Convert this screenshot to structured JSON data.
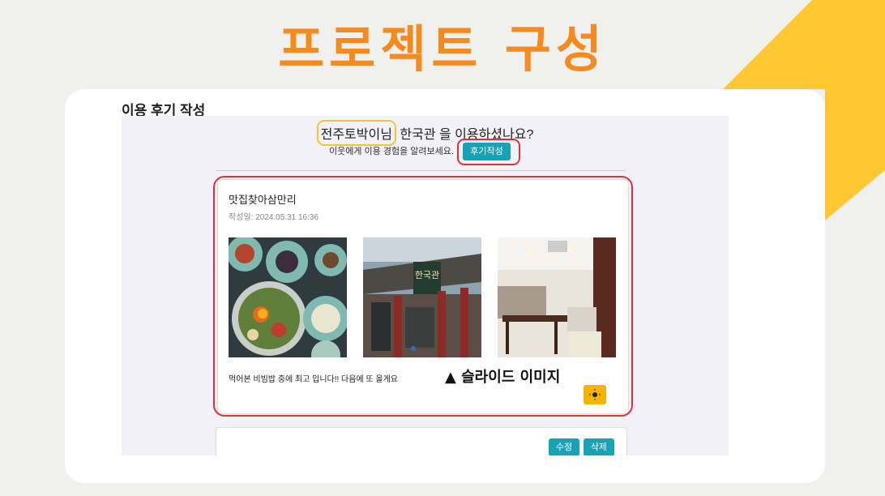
{
  "slide": {
    "title": "프로젝트 구성",
    "section_title": "이용 후기 작성",
    "accent_color": "#f58a1f",
    "deco_color": "#ffc832",
    "highlight_color": "#e0303a"
  },
  "screen": {
    "user_name": "전주토박이님",
    "question_rest": " 한국관 을 이용하셨나요?",
    "invite_text": "이웃에게 이용 경험을 알려보세요.",
    "write_button": "후기작성",
    "review": {
      "author": "맛집찾아삼만리",
      "date": "작성일: 2024.05.31 16:36",
      "photos": [
        "bibimbap-photo",
        "restaurant-exterior-photo",
        "restaurant-interior-photo"
      ],
      "body": "먹어본 비빔밥 중에 최고 입니다!! 다음에 또 올게요",
      "sun_icon": "sun-icon"
    },
    "slide_caption": "▲ 슬라이드 이미지",
    "edit_button": "수정",
    "delete_button": "삭제",
    "button_color": "#17a2b8"
  }
}
